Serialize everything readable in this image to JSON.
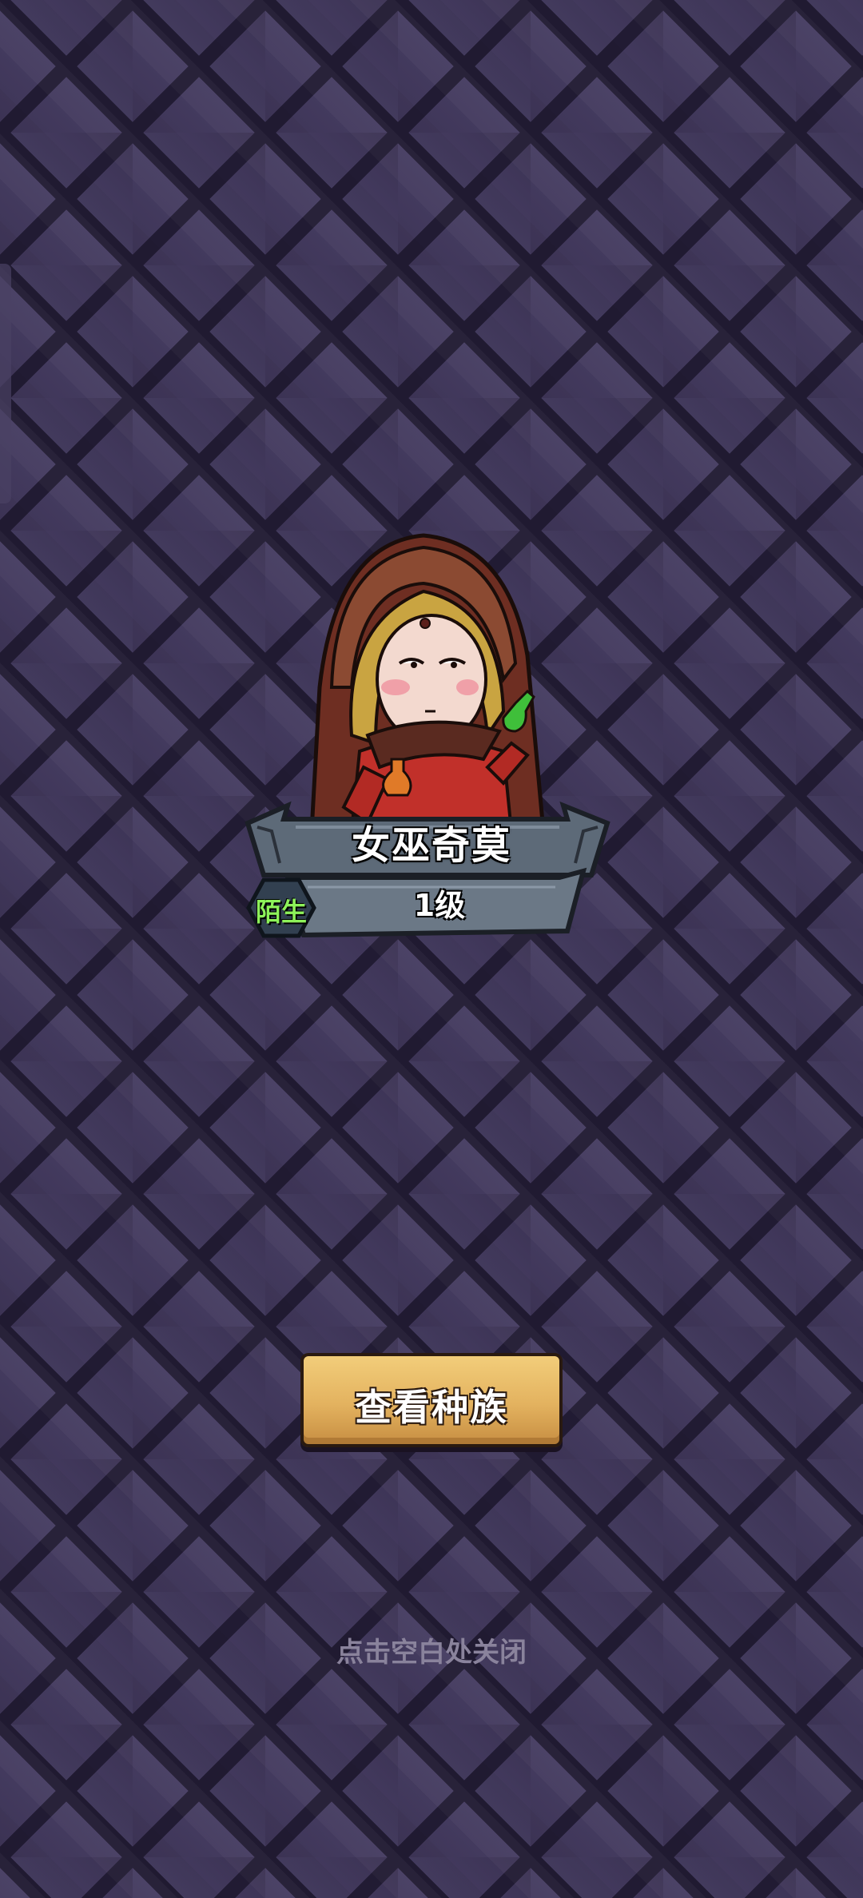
{
  "hero": {
    "name": "女巫奇莫",
    "level": "1级",
    "relation": "陌生"
  },
  "actions": {
    "view_race_label": "查看种族",
    "close_hint": "点击空白处关闭"
  },
  "colors": {
    "background": "#3a3252",
    "relation_text": "#8df25a",
    "button_gold": "#e3b25f",
    "hint_text": "#8a839c"
  }
}
